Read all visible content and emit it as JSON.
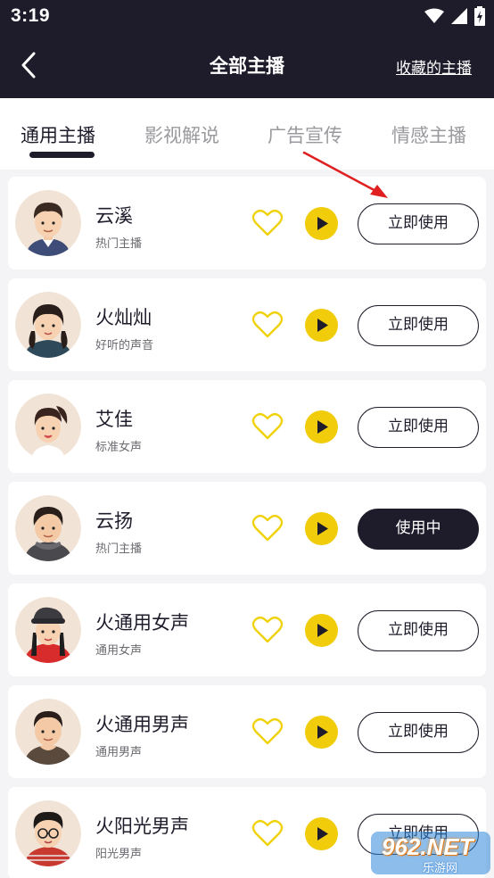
{
  "status_bar": {
    "time": "3:19"
  },
  "header": {
    "title": "全部主播",
    "favorites_link": "收藏的主播"
  },
  "tabs": [
    {
      "label": "通用主播",
      "active": true
    },
    {
      "label": "影视解说",
      "active": false
    },
    {
      "label": "广告宣传",
      "active": false
    },
    {
      "label": "情感主播",
      "active": false
    }
  ],
  "anchors": [
    {
      "name": "云溪",
      "desc": "热门主播",
      "button": "立即使用",
      "in_use": false
    },
    {
      "name": "火灿灿",
      "desc": "好听的声音",
      "button": "立即使用",
      "in_use": false
    },
    {
      "name": "艾佳",
      "desc": "标准女声",
      "button": "立即使用",
      "in_use": false
    },
    {
      "name": "云扬",
      "desc": "热门主播",
      "button": "使用中",
      "in_use": true
    },
    {
      "name": "火通用女声",
      "desc": "通用女声",
      "button": "立即使用",
      "in_use": false
    },
    {
      "name": "火通用男声",
      "desc": "通用男声",
      "button": "立即使用",
      "in_use": false
    },
    {
      "name": "火阳光男声",
      "desc": "阳光男声",
      "button": "立即使用",
      "in_use": false
    }
  ],
  "watermark": {
    "text": "962.NET",
    "sub": "乐游网"
  },
  "colors": {
    "header_bg": "#1e1c2a",
    "accent_yellow": "#f0cc0a",
    "annotation_red": "#e02020"
  }
}
